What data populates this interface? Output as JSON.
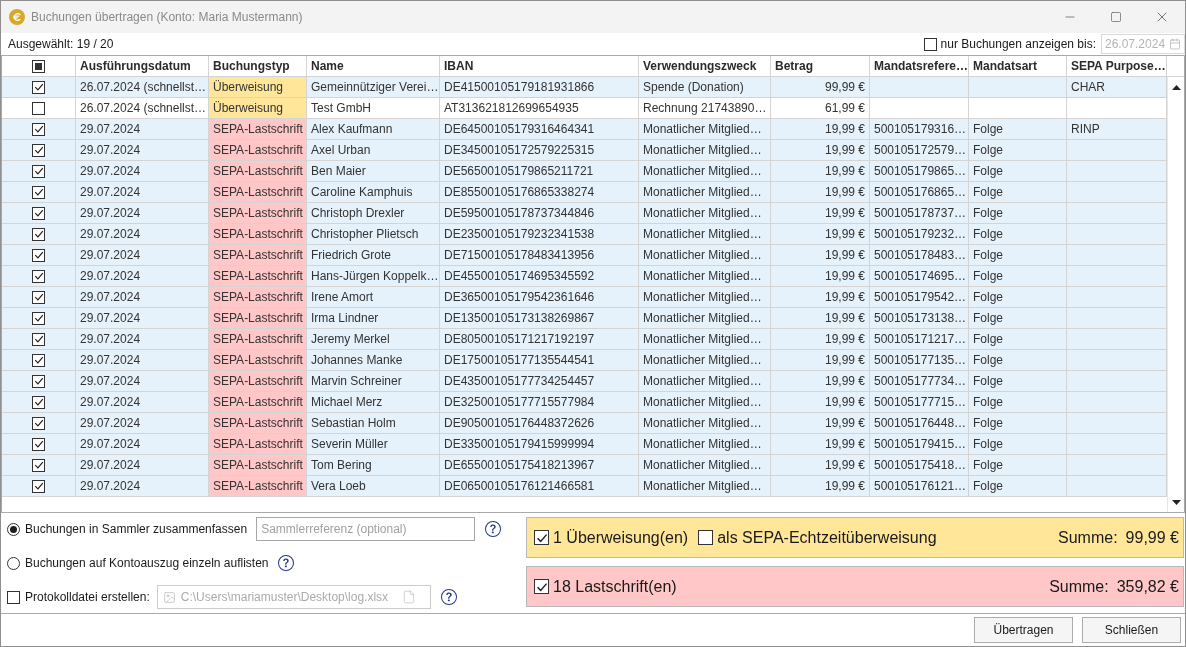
{
  "window": {
    "title": "Buchungen übertragen (Konto: Maria Mustermann)"
  },
  "selection_count": "Ausgewählt: 19 / 20",
  "date_filter": {
    "checked": false,
    "label": "nur Buchungen anzeigen bis:",
    "date": "26.07.2024",
    "disabled": true
  },
  "table": {
    "select_all": {
      "checked": false,
      "partial": true
    },
    "columns": [
      "Ausführungsdatum",
      "Buchungstyp",
      "Name",
      "IBAN",
      "Verwendungszweck",
      "Betrag",
      "Mandatsrefere…",
      "Mandatsart",
      "SEPA Purpose…"
    ],
    "rows": [
      {
        "checked": true,
        "date": "26.07.2024 (schnellst…",
        "type": "Überweisung",
        "color": "#ffe699",
        "name": "Gemeinnütziger Verei…",
        "iban": "DE41500105179181931866",
        "purpose": "Spende (Donation)",
        "amount": "99,99 €",
        "sepa_purpose": "CHAR"
      },
      {
        "checked": false,
        "date": "26.07.2024 (schnellst…",
        "type": "Überweisung",
        "color": "#ffe699",
        "name": "Test GmbH",
        "iban": "AT313621812699654935",
        "purpose": "Rechnung 21743890…",
        "amount": "61,99 €"
      },
      {
        "checked": true,
        "date": "29.07.2024",
        "type": "SEPA-Lastschrift",
        "color": "#ffc7c7",
        "name": "Alex Kaufmann",
        "iban": "DE64500105179316464341",
        "purpose": "Monatlicher Mitglied…",
        "amount": "19,99 €",
        "mandate_reference": "500105179316…",
        "mandate_type": "Folge",
        "sepa_purpose": "RINP"
      },
      {
        "checked": true,
        "date": "29.07.2024",
        "type": "SEPA-Lastschrift",
        "color": "#ffc7c7",
        "name": "Axel Urban",
        "iban": "DE34500105172579225315",
        "purpose": "Monatlicher Mitglied…",
        "amount": "19,99 €",
        "mandate_reference": "500105172579…",
        "mandate_type": "Folge"
      },
      {
        "checked": true,
        "date": "29.07.2024",
        "type": "SEPA-Lastschrift",
        "color": "#ffc7c7",
        "name": "Ben Maier",
        "iban": "DE56500105179865211721",
        "purpose": "Monatlicher Mitglied…",
        "amount": "19,99 €",
        "mandate_reference": "500105179865…",
        "mandate_type": "Folge"
      },
      {
        "checked": true,
        "date": "29.07.2024",
        "type": "SEPA-Lastschrift",
        "color": "#ffc7c7",
        "name": "Caroline Kamphuis",
        "iban": "DE85500105176865338274",
        "purpose": "Monatlicher Mitglied…",
        "amount": "19,99 €",
        "mandate_reference": "500105176865…",
        "mandate_type": "Folge"
      },
      {
        "checked": true,
        "date": "29.07.2024",
        "type": "SEPA-Lastschrift",
        "color": "#ffc7c7",
        "name": "Christoph Drexler",
        "iban": "DE59500105178737344846",
        "purpose": "Monatlicher Mitglied…",
        "amount": "19,99 €",
        "mandate_reference": "500105178737…",
        "mandate_type": "Folge"
      },
      {
        "checked": true,
        "date": "29.07.2024",
        "type": "SEPA-Lastschrift",
        "color": "#ffc7c7",
        "name": "Christopher Plietsch",
        "iban": "DE23500105179232341538",
        "purpose": "Monatlicher Mitglied…",
        "amount": "19,99 €",
        "mandate_reference": "500105179232…",
        "mandate_type": "Folge"
      },
      {
        "checked": true,
        "date": "29.07.2024",
        "type": "SEPA-Lastschrift",
        "color": "#ffc7c7",
        "name": "Friedrich Grote",
        "iban": "DE71500105178483413956",
        "purpose": "Monatlicher Mitglied…",
        "amount": "19,99 €",
        "mandate_reference": "500105178483…",
        "mandate_type": "Folge"
      },
      {
        "checked": true,
        "date": "29.07.2024",
        "type": "SEPA-Lastschrift",
        "color": "#ffc7c7",
        "name": "Hans-Jürgen Koppelk…",
        "iban": "DE45500105174695345592",
        "purpose": "Monatlicher Mitglied…",
        "amount": "19,99 €",
        "mandate_reference": "500105174695…",
        "mandate_type": "Folge"
      },
      {
        "checked": true,
        "date": "29.07.2024",
        "type": "SEPA-Lastschrift",
        "color": "#ffc7c7",
        "name": "Irene Amort",
        "iban": "DE36500105179542361646",
        "purpose": "Monatlicher Mitglied…",
        "amount": "19,99 €",
        "mandate_reference": "500105179542…",
        "mandate_type": "Folge"
      },
      {
        "checked": true,
        "date": "29.07.2024",
        "type": "SEPA-Lastschrift",
        "color": "#ffc7c7",
        "name": "Irma Lindner",
        "iban": "DE13500105173138269867",
        "purpose": "Monatlicher Mitglied…",
        "amount": "19,99 €",
        "mandate_reference": "500105173138…",
        "mandate_type": "Folge"
      },
      {
        "checked": true,
        "date": "29.07.2024",
        "type": "SEPA-Lastschrift",
        "color": "#ffc7c7",
        "name": "Jeremy Merkel",
        "iban": "DE80500105171217192197",
        "purpose": "Monatlicher Mitglied…",
        "amount": "19,99 €",
        "mandate_reference": "500105171217…",
        "mandate_type": "Folge"
      },
      {
        "checked": true,
        "date": "29.07.2024",
        "type": "SEPA-Lastschrift",
        "color": "#ffc7c7",
        "name": "Johannes Manke",
        "iban": "DE17500105177135544541",
        "purpose": "Monatlicher Mitglied…",
        "amount": "19,99 €",
        "mandate_reference": "500105177135…",
        "mandate_type": "Folge"
      },
      {
        "checked": true,
        "date": "29.07.2024",
        "type": "SEPA-Lastschrift",
        "color": "#ffc7c7",
        "name": "Marvin Schreiner",
        "iban": "DE43500105177734254457",
        "purpose": "Monatlicher Mitglied…",
        "amount": "19,99 €",
        "mandate_reference": "500105177734…",
        "mandate_type": "Folge"
      },
      {
        "checked": true,
        "date": "29.07.2024",
        "type": "SEPA-Lastschrift",
        "color": "#ffc7c7",
        "name": "Michael Merz",
        "iban": "DE32500105177715577984",
        "purpose": "Monatlicher Mitglied…",
        "amount": "19,99 €",
        "mandate_reference": "500105177715…",
        "mandate_type": "Folge"
      },
      {
        "checked": true,
        "date": "29.07.2024",
        "type": "SEPA-Lastschrift",
        "color": "#ffc7c7",
        "name": "Sebastian Holm",
        "iban": "DE90500105176448372626",
        "purpose": "Monatlicher Mitglied…",
        "amount": "19,99 €",
        "mandate_reference": "500105176448…",
        "mandate_type": "Folge"
      },
      {
        "checked": true,
        "date": "29.07.2024",
        "type": "SEPA-Lastschrift",
        "color": "#ffc7c7",
        "name": "Severin Müller",
        "iban": "DE33500105179415999994",
        "purpose": "Monatlicher Mitglied…",
        "amount": "19,99 €",
        "mandate_reference": "500105179415…",
        "mandate_type": "Folge"
      },
      {
        "checked": true,
        "date": "29.07.2024",
        "type": "SEPA-Lastschrift",
        "color": "#ffc7c7",
        "name": "Tom Bering",
        "iban": "DE65500105175418213967",
        "purpose": "Monatlicher Mitglied…",
        "amount": "19,99 €",
        "mandate_reference": "500105175418…",
        "mandate_type": "Folge"
      },
      {
        "checked": true,
        "date": "29.07.2024",
        "type": "SEPA-Lastschrift",
        "color": "#ffc7c7",
        "name": "Vera Loeb",
        "iban": "DE06500105176121466581",
        "purpose": "Monatlicher Mitglied…",
        "amount": "19,99 €",
        "mandate_reference": "500105176121…",
        "mandate_type": "Folge"
      }
    ]
  },
  "booking_modes": [
    {
      "label": "Buchungen in Sammler zusammenfassen",
      "selected": true
    },
    {
      "label": "Buchungen auf Kontoauszug einzeln auflisten",
      "selected": false
    }
  ],
  "collector_reference": {
    "placeholder": "Sammlerreferenz (optional)"
  },
  "log_file": {
    "checked": false,
    "label": "Protokolldatei erstellen:",
    "path": "C:\\Users\\mariamuster\\Desktop\\log.xlsx",
    "disabled": true
  },
  "summaries": [
    {
      "checked": true,
      "label": "1 Überweisung(en)",
      "color": "#ffe699",
      "option": {
        "checked": false,
        "label": "als SEPA-Echtzeitüberweisung"
      },
      "sum_label": "Summe:",
      "sum": "99,99 €"
    },
    {
      "checked": true,
      "label": "18 Lastschrift(en)",
      "color": "#ffc7c7",
      "sum_label": "Summe:",
      "sum": "359,82 €"
    }
  ],
  "buttons": [
    "Übertragen",
    "Schließen"
  ]
}
